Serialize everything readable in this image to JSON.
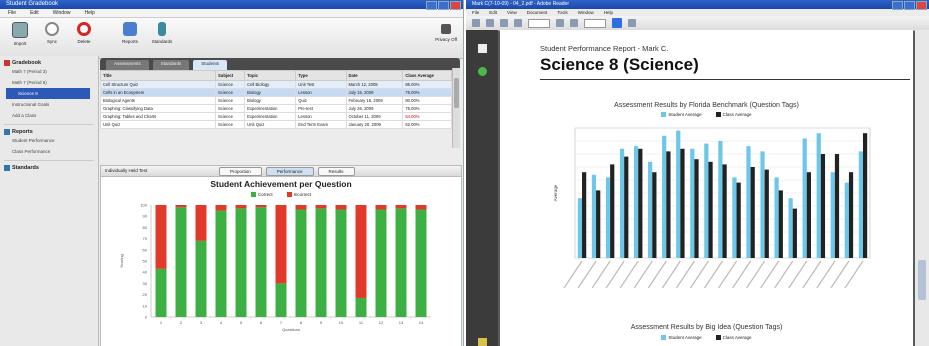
{
  "left_app": {
    "title": "Student Gradebook",
    "menu": [
      "File",
      "Edit",
      "Window",
      "Help"
    ],
    "toolbar": [
      {
        "label": "Import",
        "icon": "import-icon"
      },
      {
        "label": "Sync",
        "icon": "sync-icon"
      },
      {
        "label": "Delete",
        "icon": "delete-icon"
      },
      {
        "label": "Reports",
        "icon": "reports-icon"
      },
      {
        "label": "Standards",
        "icon": "standards-icon"
      }
    ],
    "privacy_label": "Privacy Off",
    "sidebar": {
      "sections": [
        {
          "label": "Gradebook",
          "items": [
            "Math 7 (Period 3)",
            "Math 7 (Period 5)",
            "Science 8",
            "Instructional Goals",
            "Add a Class"
          ]
        },
        {
          "label": "Reports",
          "items": [
            "Student Performance",
            "Class Performance"
          ]
        },
        {
          "label": "Standards",
          "items": []
        }
      ]
    },
    "tabs": [
      "Assessments",
      "Standards",
      "Students"
    ],
    "table": {
      "headers": [
        "Title",
        "Subject",
        "Topic",
        "Type",
        "Date",
        "Class Average"
      ],
      "rows": [
        [
          "Cell Structure Quiz",
          "Science",
          "Cell Biology",
          "Unit Test",
          "March 12, 2009",
          "85.00%"
        ],
        [
          "Cells in an Ecosystem",
          "Science",
          "Biology",
          "Lesson",
          "July 15, 2009",
          "76.00%"
        ],
        [
          "Biological Agents",
          "Science",
          "Biology",
          "Quiz",
          "February 16, 2009",
          "80.00%"
        ],
        [
          "Graphing: Classifying Data",
          "Science",
          "Experimentation",
          "Pre-test",
          "July 26, 2009",
          "75.00%"
        ],
        [
          "Graphing: Tables and Charts",
          "Science",
          "Experimentation",
          "Lesson",
          "October 11, 2009",
          "54.00%"
        ],
        [
          "Unit Quiz",
          "Science",
          "Unit Quiz",
          "End Term Exam",
          "January 20, 2009",
          "62.00%"
        ]
      ]
    },
    "analysis_panel": {
      "title": "Individually Held Test",
      "buttons": [
        "Proportion",
        "Performance",
        "Results"
      ],
      "active_button": "Performance"
    }
  },
  "right_app": {
    "title": "Mark C(7-10-09) - 04_2.pdf - Adobe Reader",
    "menu": [
      "File",
      "Edit",
      "View",
      "Document",
      "Tools",
      "Window",
      "Help"
    ],
    "report_subtitle": "Student Performance Report - Mark C.",
    "report_title": "Science 8 (Science)",
    "chart2_title": "Assessment Results by Florida Benchmark (Question Tags)",
    "chart2_ylabel": "Average",
    "chart3_title": "Assessment Results by Big Idea (Question Tags)"
  },
  "colors": {
    "correct": "#3cb043",
    "incorrect": "#e03a2a",
    "student_avg": "#6cc7e8",
    "class_avg": "#222222"
  },
  "chart_data": [
    {
      "type": "bar",
      "stacked": true,
      "title": "Student Achievement per Question",
      "xlabel": "Questions",
      "ylabel": "Scoring",
      "categories": [
        "1",
        "2",
        "3",
        "4",
        "5",
        "6",
        "7",
        "8",
        "9",
        "10",
        "11",
        "12",
        "13",
        "14"
      ],
      "ylim": [
        0,
        100
      ],
      "yticks": [
        0,
        10,
        20,
        30,
        40,
        50,
        60,
        70,
        80,
        90,
        100
      ],
      "series": [
        {
          "name": "Correct",
          "color": "#3cb043",
          "values": [
            43,
            98,
            68,
            95,
            97,
            98,
            30,
            96,
            97,
            96,
            17,
            96,
            97,
            96
          ]
        },
        {
          "name": "Incorrect",
          "color": "#e03a2a",
          "values": [
            57,
            2,
            32,
            5,
            3,
            2,
            70,
            4,
            3,
            4,
            83,
            4,
            3,
            4
          ]
        }
      ]
    },
    {
      "type": "bar",
      "title": "Assessment Results by Florida Benchmark (Question Tags)",
      "ylabel": "Average",
      "ylim": [
        0,
        100
      ],
      "categories": [
        "",
        "",
        "",
        "",
        "",
        "",
        "",
        "",
        "",
        "",
        "",
        "",
        "",
        "",
        "",
        "",
        "",
        "",
        "",
        "",
        ""
      ],
      "series": [
        {
          "name": "Student Average",
          "color": "#6cc7e8",
          "values": [
            46,
            64,
            62,
            84,
            86,
            74,
            94,
            98,
            84,
            88,
            90,
            62,
            86,
            82,
            62,
            46,
            92,
            96,
            66,
            58,
            82
          ]
        },
        {
          "name": "Class Average",
          "color": "#222222",
          "values": [
            66,
            52,
            72,
            78,
            84,
            66,
            82,
            84,
            76,
            74,
            72,
            58,
            70,
            68,
            52,
            38,
            66,
            80,
            80,
            66,
            96
          ]
        }
      ]
    }
  ]
}
